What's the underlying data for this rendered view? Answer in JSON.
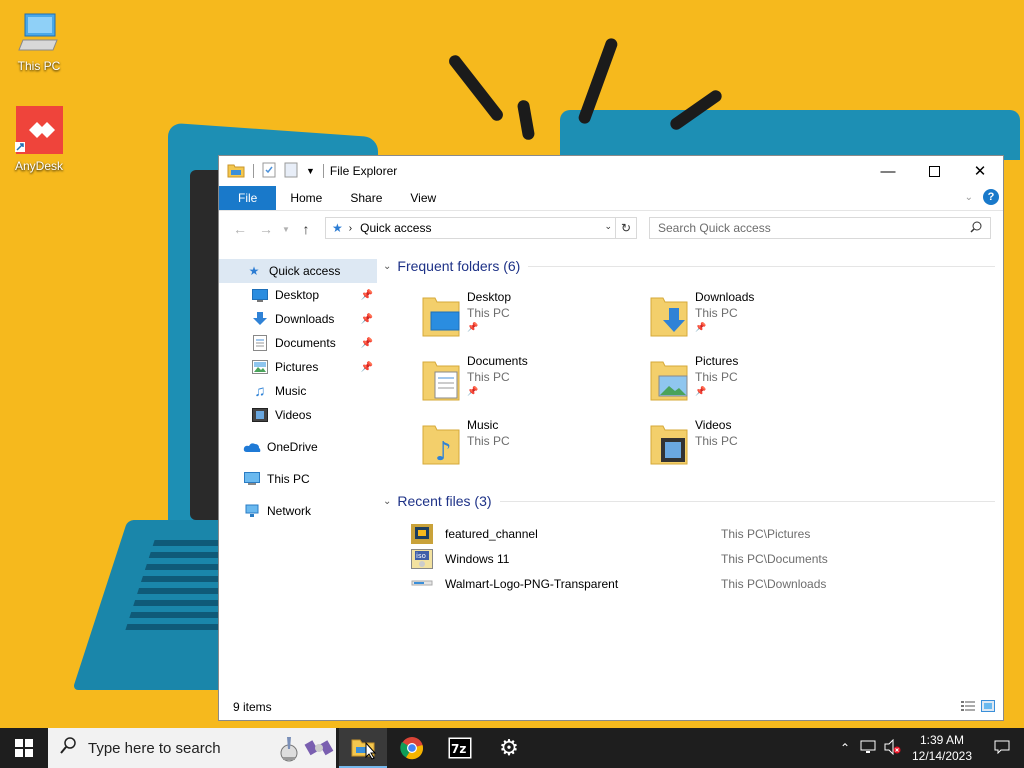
{
  "desktop": {
    "icons": [
      {
        "label": "This PC"
      },
      {
        "label": "AnyDesk"
      }
    ]
  },
  "window": {
    "title": "File Explorer",
    "ribbon_tabs": [
      "File",
      "Home",
      "Share",
      "View"
    ],
    "address": "Quick access",
    "search_placeholder": "Search Quick access",
    "status": "9 items"
  },
  "nav_pane": {
    "items": [
      {
        "label": "Quick access",
        "icon": "quick-access-star-icon"
      },
      {
        "label": "Desktop",
        "icon": "desktop-icon",
        "pinned": true
      },
      {
        "label": "Downloads",
        "icon": "downloads-icon",
        "pinned": true
      },
      {
        "label": "Documents",
        "icon": "documents-icon",
        "pinned": true
      },
      {
        "label": "Pictures",
        "icon": "pictures-icon",
        "pinned": true
      },
      {
        "label": "Music",
        "icon": "music-icon"
      },
      {
        "label": "Videos",
        "icon": "videos-icon"
      },
      {
        "label": "OneDrive",
        "icon": "onedrive-icon"
      },
      {
        "label": "This PC",
        "icon": "this-pc-icon"
      },
      {
        "label": "Network",
        "icon": "network-icon"
      }
    ]
  },
  "frequent": {
    "header": "Frequent folders (6)",
    "folders": [
      {
        "name": "Desktop",
        "location": "This PC"
      },
      {
        "name": "Downloads",
        "location": "This PC"
      },
      {
        "name": "Documents",
        "location": "This PC"
      },
      {
        "name": "Pictures",
        "location": "This PC"
      },
      {
        "name": "Music",
        "location": "This PC"
      },
      {
        "name": "Videos",
        "location": "This PC"
      }
    ]
  },
  "recent": {
    "header": "Recent files (3)",
    "files": [
      {
        "name": "featured_channel",
        "path": "This PC\\Pictures"
      },
      {
        "name": "Windows 11",
        "path": "This PC\\Documents"
      },
      {
        "name": "Walmart-Logo-PNG-Transparent",
        "path": "This PC\\Downloads"
      }
    ]
  },
  "taskbar": {
    "search_placeholder": "Type here to search",
    "time": "1:39 AM",
    "date": "12/14/2023",
    "apps": [
      "File Explorer",
      "Google Chrome",
      "7-Zip",
      "Settings"
    ]
  },
  "colors": {
    "accent": "#1979ca",
    "wallpaper": "#f6b91d",
    "taskbar": "#1e1e1e"
  }
}
